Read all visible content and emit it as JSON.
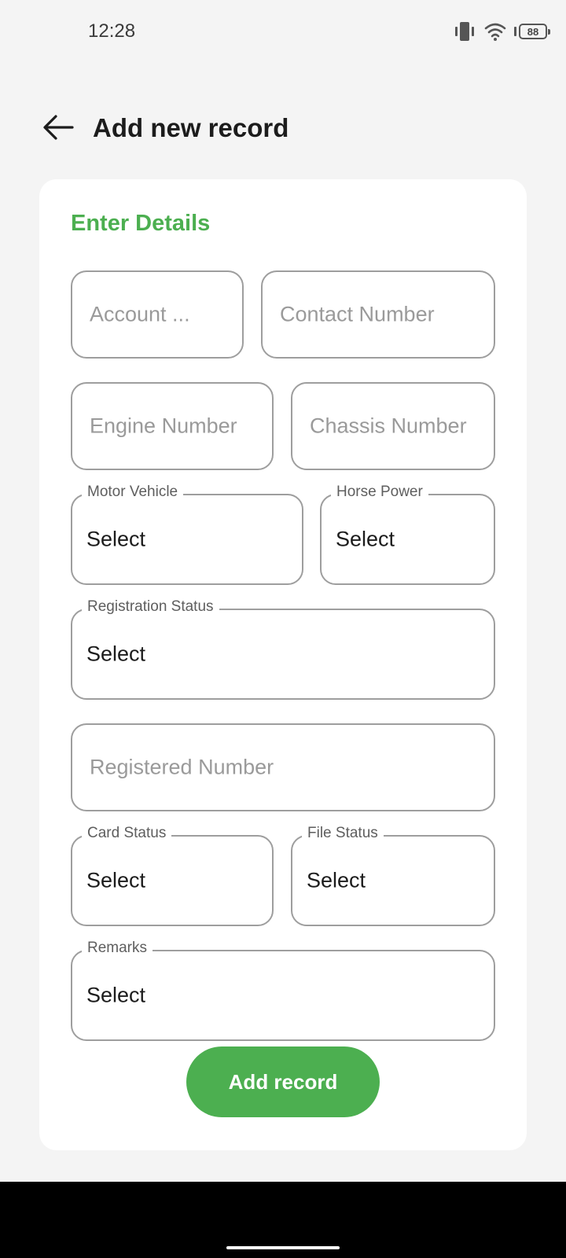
{
  "status_bar": {
    "time": "12:28",
    "battery_level": "88",
    "icons": [
      "vibrate-icon",
      "wifi-icon",
      "battery-icon"
    ]
  },
  "header": {
    "back_icon": "arrow-left-icon",
    "title": "Add new record"
  },
  "form": {
    "section_title": "Enter Details",
    "account_placeholder": "Account ...",
    "contact_placeholder": "Contact Number",
    "engine_placeholder": "Engine Number",
    "chassis_placeholder": "Chassis Number",
    "motor_vehicle": {
      "label": "Motor Vehicle",
      "value": "Select"
    },
    "horse_power": {
      "label": "Horse Power",
      "value": "Select"
    },
    "registration_status": {
      "label": "Registration Status",
      "value": "Select"
    },
    "registered_placeholder": "Registered Number",
    "card_status": {
      "label": "Card Status",
      "value": "Select"
    },
    "file_status": {
      "label": "File Status",
      "value": "Select"
    },
    "remarks": {
      "label": "Remarks",
      "value": "Select"
    },
    "submit_label": "Add record"
  },
  "colors": {
    "accent": "#4caf50",
    "background": "#f4f4f4",
    "card": "#ffffff",
    "field_border": "#9e9e9e",
    "placeholder": "#9a9a9a"
  }
}
